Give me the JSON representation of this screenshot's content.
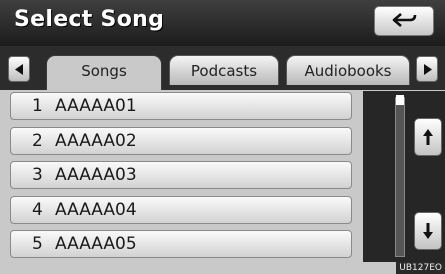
{
  "header": {
    "title": "Select Song"
  },
  "tabs": [
    {
      "label": "Songs",
      "active": true
    },
    {
      "label": "Podcasts",
      "active": false
    },
    {
      "label": "Audiobooks",
      "active": false
    }
  ],
  "songs": [
    {
      "number": "1",
      "name": "AAAAA01"
    },
    {
      "number": "2",
      "name": "AAAAA02"
    },
    {
      "number": "3",
      "name": "AAAAA03"
    },
    {
      "number": "4",
      "name": "AAAAA04"
    },
    {
      "number": "5",
      "name": "AAAAA05"
    }
  ],
  "icons": {
    "back": "back-arrow-icon",
    "tab_left": "triangle-left-icon",
    "tab_right": "triangle-right-icon",
    "scroll_up": "page-up-icon",
    "scroll_down": "page-down-icon"
  },
  "watermark": "UB127EO"
}
